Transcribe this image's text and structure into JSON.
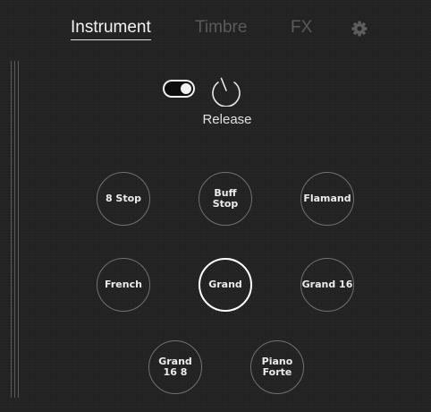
{
  "tabs": {
    "instrument": "Instrument",
    "timbre": "Timbre",
    "fx": "FX",
    "settings_icon": "gear-icon"
  },
  "controls": {
    "toggle_state": "on",
    "knob_label": "Release"
  },
  "stops": [
    {
      "label": "8 Stop",
      "selected": false
    },
    {
      "label": "Buff\nStop",
      "selected": false
    },
    {
      "label": "Flamand",
      "selected": false
    },
    {
      "label": "French",
      "selected": false
    },
    {
      "label": "Grand",
      "selected": true
    },
    {
      "label": "Grand 16",
      "selected": false
    },
    {
      "label": "Grand\n16 8",
      "selected": false
    },
    {
      "label": "Piano\nForte",
      "selected": false
    }
  ],
  "colors": {
    "background": "#222222",
    "active_text": "#f2f2f2",
    "inactive_text": "#5a5a5a",
    "ring": "#707070",
    "selected_ring": "#ffffff"
  }
}
